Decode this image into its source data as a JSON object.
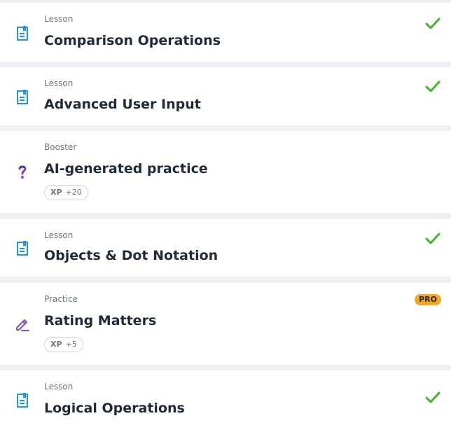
{
  "colors": {
    "lesson_icon": "#2096e6",
    "booster_icon": "#8a3fd1",
    "practice_icon": "#7c4dd4",
    "check": "#45b32a",
    "pro_badge": "#f4a81d",
    "title_text": "#1d2b3a",
    "meta_text": "#6b7785",
    "separator": "#eef0f3"
  },
  "items": [
    {
      "kind": "Lesson",
      "title": "Comparison Operations",
      "icon": "lesson-doc-icon",
      "completed": true
    },
    {
      "kind": "Lesson",
      "title": "Advanced User Input",
      "icon": "lesson-doc-icon",
      "completed": true
    },
    {
      "kind": "Booster",
      "title": "AI-generated practice",
      "icon": "question-mark-icon",
      "xp_label": "XP",
      "xp_value": "+20"
    },
    {
      "kind": "Lesson",
      "title": "Objects & Dot Notation",
      "icon": "lesson-doc-icon",
      "completed": true
    },
    {
      "kind": "Practice",
      "title": "Rating Matters",
      "icon": "pencil-icon",
      "badge": "PRO",
      "xp_label": "XP",
      "xp_value": "+5"
    },
    {
      "kind": "Lesson",
      "title": "Logical Operations",
      "icon": "lesson-doc-icon",
      "completed": true
    }
  ]
}
